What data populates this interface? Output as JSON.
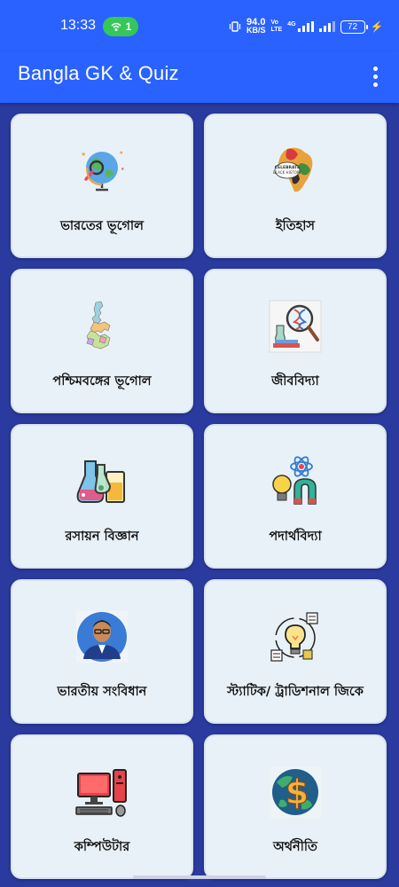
{
  "status_bar": {
    "time": "13:33",
    "hotspot_count": "1",
    "net_speed_value": "94.0",
    "net_speed_unit": "KB/S",
    "vo_label": "Vo",
    "lte_label": "LTE",
    "network_type": "4G",
    "battery": "72"
  },
  "app_bar": {
    "title": "Bangla GK & Quiz",
    "menu_icon": "more-vert-icon"
  },
  "categories": [
    {
      "label": "ভারতের ভূগোল",
      "icon": "globe-icon"
    },
    {
      "label": "ইতিহাস",
      "icon": "history-map-icon"
    },
    {
      "label": "পশ্চিমবঙ্গের ভূগোল",
      "icon": "west-bengal-map-icon"
    },
    {
      "label": "জীববিদ্যা",
      "icon": "microscope-dna-icon"
    },
    {
      "label": "রসায়ন বিজ্ঞান",
      "icon": "chemistry-flasks-icon"
    },
    {
      "label": "পদার্থবিদ্যা",
      "icon": "physics-atom-icon"
    },
    {
      "label": "ভারতীয় সংবিধান",
      "icon": "ambedkar-portrait-icon"
    },
    {
      "label": "স্ট্যাটিক/ ট্রাডিশনাল জিকে",
      "icon": "bulb-ideas-icon"
    },
    {
      "label": "কম্পিউটার",
      "icon": "computer-icon"
    },
    {
      "label": "অর্থনীতি",
      "icon": "economy-globe-dollar-icon"
    }
  ],
  "colors": {
    "app_bar": "#2962ff",
    "background": "#2b3a9e",
    "card": "#e9f1f8",
    "hotspot": "#35c758"
  }
}
